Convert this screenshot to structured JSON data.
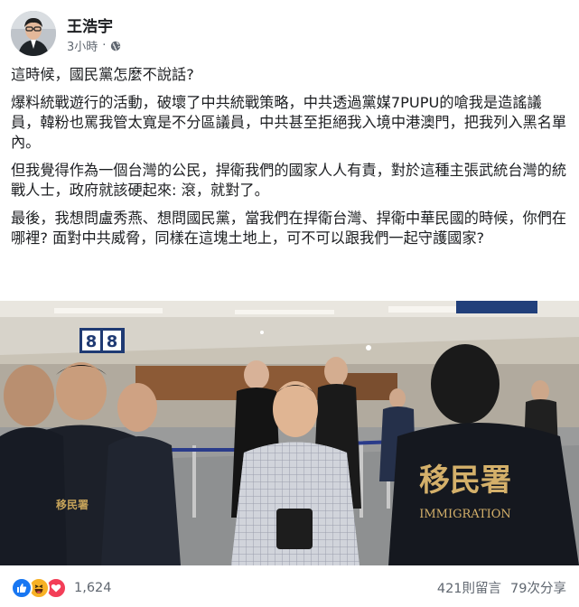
{
  "post": {
    "author": "王浩宇",
    "timestamp": "3小時",
    "separator": "·",
    "privacy_icon": "globe-icon",
    "paragraphs": [
      "這時候，國民黨怎麼不說話?",
      "爆料統戰遊行的活動，破壞了中共統戰策略，中共透過黨媒7PUPU的嗆我是造謠議員，韓粉也罵我管太寬是不分區議員，中共甚至拒絕我入境中港澳門，把我列入黑名單內。",
      "但我覺得作為一個台灣的公民，捍衛我們的國家人人有責，對於這種主張武統台灣的統戰人士，政府就該硬起來: 滾，就對了。",
      "最後，我想問盧秀燕、想問國民黨，當我們在捍衛台灣、捍衛中華民國的時候，你們在哪裡? 面對中共威脅，同樣在這塊土地上，可不可以跟我們一起守護國家?"
    ]
  },
  "photo": {
    "gate_number": "8",
    "vest_text": "移民署",
    "vest_text_en": "IMMIGRATION",
    "left_vest_text": "移民署"
  },
  "footer": {
    "reaction_icons": [
      "like-icon",
      "haha-icon",
      "love-icon"
    ],
    "reaction_count": "1,624",
    "comments": "421則留言",
    "shares": "79次分享"
  },
  "colors": {
    "accent": "#1877f2",
    "love": "#f33e58",
    "haha": "#f7b125",
    "meta_text": "#606770"
  }
}
